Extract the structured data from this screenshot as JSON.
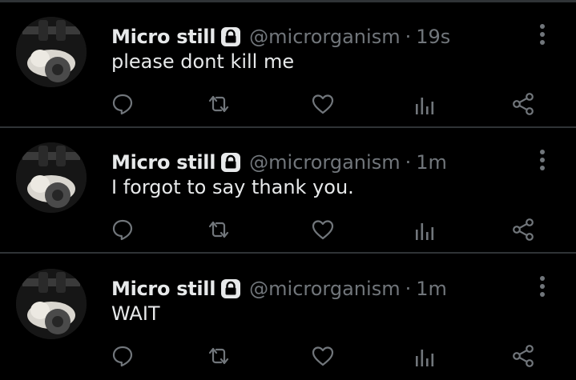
{
  "tweets": [
    {
      "author_name": "Micro still",
      "handle": "@microrganism",
      "separator": "·",
      "time": "19s",
      "text": "please dont kill me",
      "icons": {
        "lock": "lock-icon",
        "more": "more-vertical-icon",
        "reply": "reply-icon",
        "retweet": "retweet-icon",
        "like": "like-icon",
        "views": "views-icon",
        "share": "share-icon"
      }
    },
    {
      "author_name": "Micro still",
      "handle": "@microrganism",
      "separator": "·",
      "time": "1m",
      "text": "I forgot to say thank you.",
      "icons": {
        "lock": "lock-icon",
        "more": "more-vertical-icon",
        "reply": "reply-icon",
        "retweet": "retweet-icon",
        "like": "like-icon",
        "views": "views-icon",
        "share": "share-icon"
      }
    },
    {
      "author_name": "Micro still",
      "handle": "@microrganism",
      "separator": "·",
      "time": "1m",
      "text": "WAIT",
      "icons": {
        "lock": "lock-icon",
        "more": "more-vertical-icon",
        "reply": "reply-icon",
        "retweet": "retweet-icon",
        "like": "like-icon",
        "views": "views-icon",
        "share": "share-icon"
      }
    }
  ],
  "colors": {
    "background": "#000000",
    "primary_text": "#e7e9ea",
    "secondary_text": "#71767b",
    "divider": "#2f3336"
  }
}
